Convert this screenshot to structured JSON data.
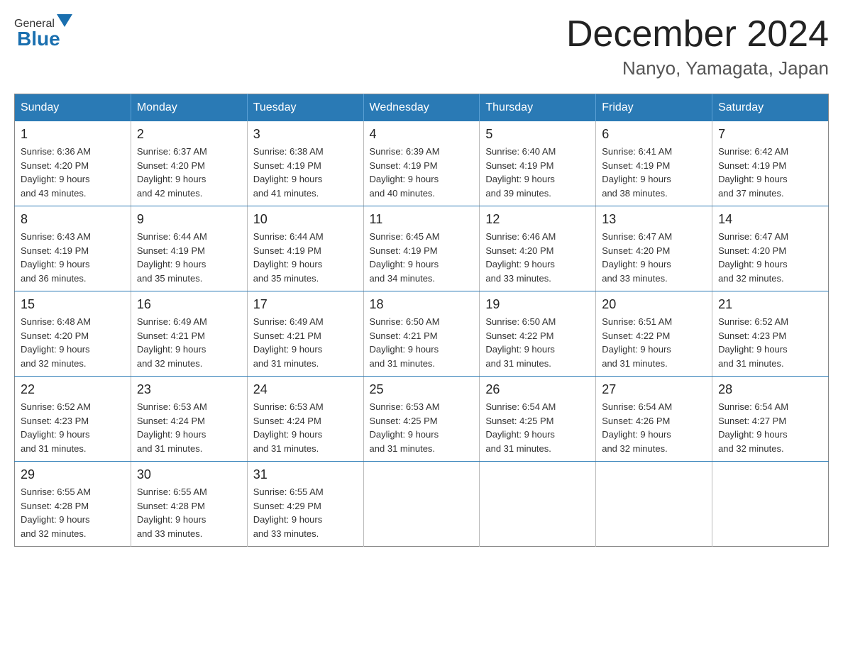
{
  "header": {
    "logo_general": "General",
    "logo_blue": "Blue",
    "month_title": "December 2024",
    "location": "Nanyo, Yamagata, Japan"
  },
  "weekdays": [
    "Sunday",
    "Monday",
    "Tuesday",
    "Wednesday",
    "Thursday",
    "Friday",
    "Saturday"
  ],
  "weeks": [
    [
      {
        "day": "1",
        "sunrise": "6:36 AM",
        "sunset": "4:20 PM",
        "daylight": "9 hours and 43 minutes."
      },
      {
        "day": "2",
        "sunrise": "6:37 AM",
        "sunset": "4:20 PM",
        "daylight": "9 hours and 42 minutes."
      },
      {
        "day": "3",
        "sunrise": "6:38 AM",
        "sunset": "4:19 PM",
        "daylight": "9 hours and 41 minutes."
      },
      {
        "day": "4",
        "sunrise": "6:39 AM",
        "sunset": "4:19 PM",
        "daylight": "9 hours and 40 minutes."
      },
      {
        "day": "5",
        "sunrise": "6:40 AM",
        "sunset": "4:19 PM",
        "daylight": "9 hours and 39 minutes."
      },
      {
        "day": "6",
        "sunrise": "6:41 AM",
        "sunset": "4:19 PM",
        "daylight": "9 hours and 38 minutes."
      },
      {
        "day": "7",
        "sunrise": "6:42 AM",
        "sunset": "4:19 PM",
        "daylight": "9 hours and 37 minutes."
      }
    ],
    [
      {
        "day": "8",
        "sunrise": "6:43 AM",
        "sunset": "4:19 PM",
        "daylight": "9 hours and 36 minutes."
      },
      {
        "day": "9",
        "sunrise": "6:44 AM",
        "sunset": "4:19 PM",
        "daylight": "9 hours and 35 minutes."
      },
      {
        "day": "10",
        "sunrise": "6:44 AM",
        "sunset": "4:19 PM",
        "daylight": "9 hours and 35 minutes."
      },
      {
        "day": "11",
        "sunrise": "6:45 AM",
        "sunset": "4:19 PM",
        "daylight": "9 hours and 34 minutes."
      },
      {
        "day": "12",
        "sunrise": "6:46 AM",
        "sunset": "4:20 PM",
        "daylight": "9 hours and 33 minutes."
      },
      {
        "day": "13",
        "sunrise": "6:47 AM",
        "sunset": "4:20 PM",
        "daylight": "9 hours and 33 minutes."
      },
      {
        "day": "14",
        "sunrise": "6:47 AM",
        "sunset": "4:20 PM",
        "daylight": "9 hours and 32 minutes."
      }
    ],
    [
      {
        "day": "15",
        "sunrise": "6:48 AM",
        "sunset": "4:20 PM",
        "daylight": "9 hours and 32 minutes."
      },
      {
        "day": "16",
        "sunrise": "6:49 AM",
        "sunset": "4:21 PM",
        "daylight": "9 hours and 32 minutes."
      },
      {
        "day": "17",
        "sunrise": "6:49 AM",
        "sunset": "4:21 PM",
        "daylight": "9 hours and 31 minutes."
      },
      {
        "day": "18",
        "sunrise": "6:50 AM",
        "sunset": "4:21 PM",
        "daylight": "9 hours and 31 minutes."
      },
      {
        "day": "19",
        "sunrise": "6:50 AM",
        "sunset": "4:22 PM",
        "daylight": "9 hours and 31 minutes."
      },
      {
        "day": "20",
        "sunrise": "6:51 AM",
        "sunset": "4:22 PM",
        "daylight": "9 hours and 31 minutes."
      },
      {
        "day": "21",
        "sunrise": "6:52 AM",
        "sunset": "4:23 PM",
        "daylight": "9 hours and 31 minutes."
      }
    ],
    [
      {
        "day": "22",
        "sunrise": "6:52 AM",
        "sunset": "4:23 PM",
        "daylight": "9 hours and 31 minutes."
      },
      {
        "day": "23",
        "sunrise": "6:53 AM",
        "sunset": "4:24 PM",
        "daylight": "9 hours and 31 minutes."
      },
      {
        "day": "24",
        "sunrise": "6:53 AM",
        "sunset": "4:24 PM",
        "daylight": "9 hours and 31 minutes."
      },
      {
        "day": "25",
        "sunrise": "6:53 AM",
        "sunset": "4:25 PM",
        "daylight": "9 hours and 31 minutes."
      },
      {
        "day": "26",
        "sunrise": "6:54 AM",
        "sunset": "4:25 PM",
        "daylight": "9 hours and 31 minutes."
      },
      {
        "day": "27",
        "sunrise": "6:54 AM",
        "sunset": "4:26 PM",
        "daylight": "9 hours and 32 minutes."
      },
      {
        "day": "28",
        "sunrise": "6:54 AM",
        "sunset": "4:27 PM",
        "daylight": "9 hours and 32 minutes."
      }
    ],
    [
      {
        "day": "29",
        "sunrise": "6:55 AM",
        "sunset": "4:28 PM",
        "daylight": "9 hours and 32 minutes."
      },
      {
        "day": "30",
        "sunrise": "6:55 AM",
        "sunset": "4:28 PM",
        "daylight": "9 hours and 33 minutes."
      },
      {
        "day": "31",
        "sunrise": "6:55 AM",
        "sunset": "4:29 PM",
        "daylight": "9 hours and 33 minutes."
      },
      null,
      null,
      null,
      null
    ]
  ],
  "labels": {
    "sunrise": "Sunrise:",
    "sunset": "Sunset:",
    "daylight": "Daylight:"
  }
}
